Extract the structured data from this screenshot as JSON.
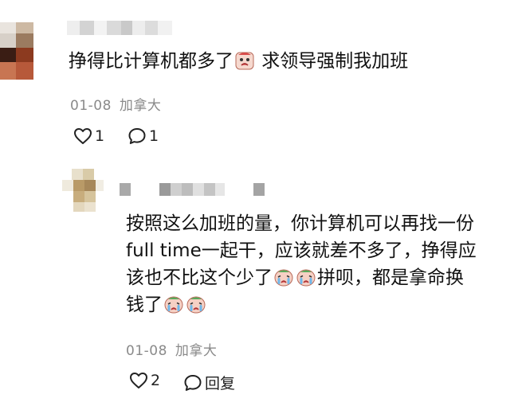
{
  "top_comment": {
    "text_before_emoji": "挣得比计算机都多了",
    "text_after_emoji": " 求领导强制我加班",
    "emoji": "crying-face-sticker",
    "date": "01-08",
    "location": "加拿大",
    "like_count": "1",
    "reply_count": "1"
  },
  "reply": {
    "line1": "按照这么加班的量，你计算机可以再找一份",
    "line2": "full time一起干，应该就差不多了，挣得应",
    "line3_before": "该也不比这个少了",
    "line3_after": "拼呗，都是拿命换",
    "line4_before": "钱了",
    "emoji": "crying-face-sticker",
    "date": "01-08",
    "location": "加拿大",
    "like_count": "2",
    "reply_label": "回复"
  },
  "colors": {
    "text": "#111111",
    "meta": "#8a8a8a",
    "background": "#ffffff"
  }
}
